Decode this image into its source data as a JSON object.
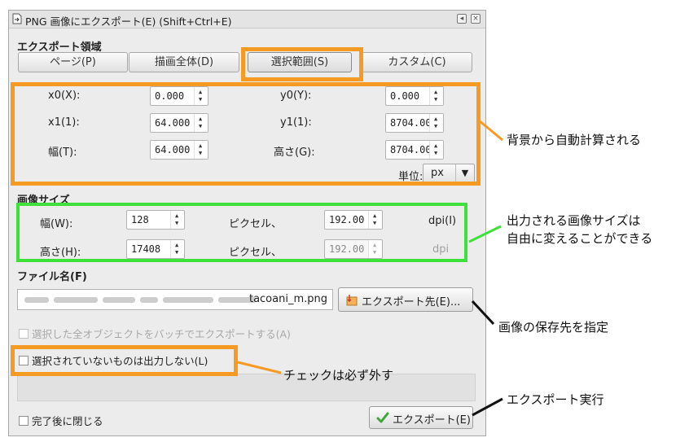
{
  "window": {
    "title": "PNG 画像にエクスポート(E)  (Shift+Ctrl+E)",
    "min_glyph": "◂",
    "close_glyph": "×"
  },
  "export_area": {
    "heading": "エクスポート領域",
    "tabs": [
      {
        "label": "ページ(P)"
      },
      {
        "label": "描画全体(D)"
      },
      {
        "label": "選択範囲(S)",
        "active": true
      },
      {
        "label": "カスタム(C)"
      }
    ],
    "x0_label": "x0(X):",
    "x0_value": "0.000",
    "y0_label": "y0(Y):",
    "y0_value": "0.000",
    "x1_label": "x1(1):",
    "x1_value": "64.000",
    "y1_label": "y1(1):",
    "y1_value": "8704.00(",
    "width_label": "幅(T):",
    "width_value": "64.000",
    "height_label": "高さ(G):",
    "height_value": "8704.00(",
    "units_label": "単位:",
    "units_value": "px"
  },
  "image_size": {
    "heading": "画像サイズ",
    "width_label": "幅(W):",
    "width_value": "128",
    "height_label": "高さ(H):",
    "height_value": "17408",
    "pixels_label_1": "ピクセル、",
    "pixels_label_2": "ピクセル、",
    "dpi_value_1": "192.00",
    "dpi_value_2": "192.00",
    "dpi_label_1": "dpi(I)",
    "dpi_label_2": "dpi"
  },
  "filename": {
    "heading": "ファイル名(F)",
    "value_tail": "tacoani_m.png",
    "browse_button": "エクスポート先(E)..."
  },
  "options": {
    "batch_export": "選択した全オブジェクトをバッチでエクスポートする(A)",
    "hide_unselected": "選択されていないものは出力しない(L)",
    "close_when_done": "完了後に閉じる"
  },
  "export_button": "エクスポート(E)",
  "annotations": {
    "auto_calc": "背景から自動計算される",
    "size_free_1": "出力される画像サイズは",
    "size_free_2": "自由に変えることができる",
    "save_location": "画像の保存先を指定",
    "uncheck": "チェックは必ず外す",
    "run_export": "エクスポート実行"
  },
  "colors": {
    "highlight_orange": "#f59a22",
    "highlight_green": "#3fe03a"
  }
}
